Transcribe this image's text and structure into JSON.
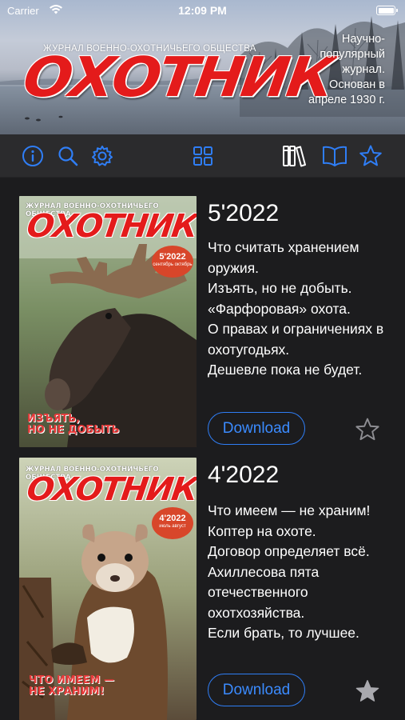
{
  "status_bar": {
    "carrier": "Carrier",
    "time": "12:09 PM"
  },
  "header": {
    "subtitle": "ЖУРНАЛ ВОЕННО-ОХОТНИЧЬЕГО ОБЩЕСТВА",
    "logo": "ОХОТНИК",
    "founded": "Научно-популярный журнал. Основан в апреле 1930 г."
  },
  "toolbar": {
    "left_icons": [
      "info-icon",
      "search-icon",
      "gear-icon"
    ],
    "center_icon": "grid-icon",
    "right_icons": [
      "library-icon",
      "book-open-icon",
      "star-icon"
    ],
    "accent": "#2f7ef6"
  },
  "issues": [
    {
      "title": "5'2022",
      "description": "Что считать хранением оружия.\nИзъять, но не добыть.\n«Фарфоровая» охота.\nО правах и ограничениях в охотугодьях.\nДешевле пока не будет.",
      "button": "Download",
      "favorite": false,
      "cover": {
        "subtitle": "ЖУРНАЛ ВОЕННО-ОХОТНИЧЬЕГО ОБЩЕСТВА",
        "logo": "ОХОТНИК",
        "badge": "5'2022",
        "badge_sub": "сентябрь октябрь",
        "headline_line1": "ИЗЪЯТЬ,",
        "headline_line2": "НО НЕ ДОБЫТЬ",
        "image": "moose"
      }
    },
    {
      "title": "4'2022",
      "description": "Что имеем — не храним!\nКоптер на охоте.\nДоговор определяет всё.\nАхиллесова пята отечественного охотхозяйства.\nЕсли брать, то лучшее.",
      "button": "Download",
      "favorite": true,
      "cover": {
        "subtitle": "ЖУРНАЛ ВОЕННО-ОХОТНИЧЬЕГО ОБЩЕСТВА",
        "logo": "ОХОТНИК",
        "badge": "4'2022",
        "badge_sub": "июль август",
        "headline_line1": "ЧТО ИМЕЕМ —",
        "headline_line2": "НЕ ХРАНИМ!",
        "image": "marten"
      }
    }
  ]
}
